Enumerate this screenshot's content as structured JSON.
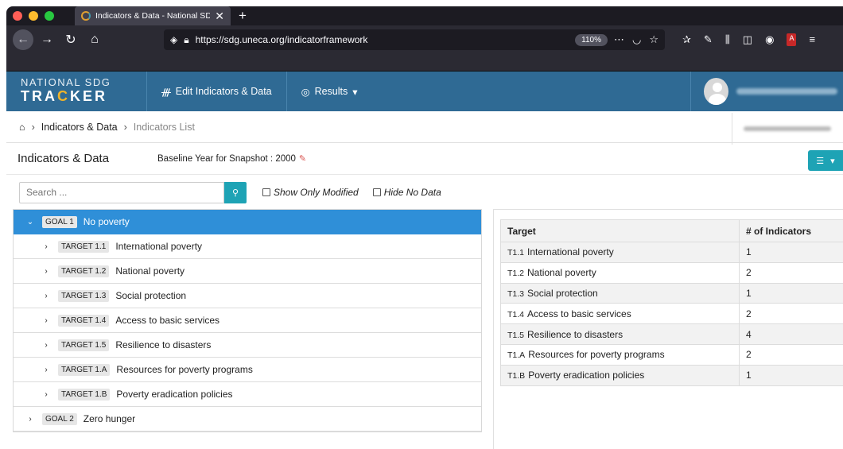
{
  "browser": {
    "tab_title": "Indicators & Data - National SD",
    "url": "https://sdg.uneca.org/indicatorframework",
    "zoom": "110%"
  },
  "app": {
    "brand_top": "NATIONAL SDG",
    "brand_bottom_a": "TRA",
    "brand_bottom_c": "C",
    "brand_bottom_b": "KER",
    "nav": {
      "edit_label": "Edit Indicators & Data",
      "results_label": "Results"
    }
  },
  "breadcrumb": {
    "first": "Indicators & Data",
    "current": "Indicators List"
  },
  "page": {
    "title": "Indicators & Data",
    "baseline": "Baseline Year for Snapshot : 2000"
  },
  "filters": {
    "search_placeholder": "Search ...",
    "show_modified": "Show Only Modified",
    "hide_no_data": "Hide No Data"
  },
  "tree": {
    "goals": [
      {
        "badge": "GOAL 1",
        "label": "No poverty"
      },
      {
        "badge": "GOAL 2",
        "label": "Zero hunger"
      }
    ],
    "targets": [
      {
        "badge": "TARGET 1.1",
        "label": "International poverty"
      },
      {
        "badge": "TARGET 1.2",
        "label": "National poverty"
      },
      {
        "badge": "TARGET 1.3",
        "label": "Social protection"
      },
      {
        "badge": "TARGET 1.4",
        "label": "Access to basic services"
      },
      {
        "badge": "TARGET 1.5",
        "label": "Resilience to disasters"
      },
      {
        "badge": "TARGET 1.A",
        "label": "Resources for poverty programs"
      },
      {
        "badge": "TARGET 1.B",
        "label": "Poverty eradication policies"
      }
    ]
  },
  "table": {
    "headers": [
      "Target",
      "# of Indicators"
    ],
    "rows": [
      {
        "code": "T1.1",
        "name": "International poverty",
        "count": "1"
      },
      {
        "code": "T1.2",
        "name": "National poverty",
        "count": "2"
      },
      {
        "code": "T1.3",
        "name": "Social protection",
        "count": "1"
      },
      {
        "code": "T1.4",
        "name": "Access to basic services",
        "count": "2"
      },
      {
        "code": "T1.5",
        "name": "Resilience to disasters",
        "count": "4"
      },
      {
        "code": "T1.A",
        "name": "Resources for poverty programs",
        "count": "2"
      },
      {
        "code": "T1.B",
        "name": "Poverty eradication policies",
        "count": "1"
      }
    ]
  },
  "colors": {
    "header_blue": "#2f6a94",
    "active_blue": "#2f8fd8",
    "teal": "#1ea3b5"
  }
}
